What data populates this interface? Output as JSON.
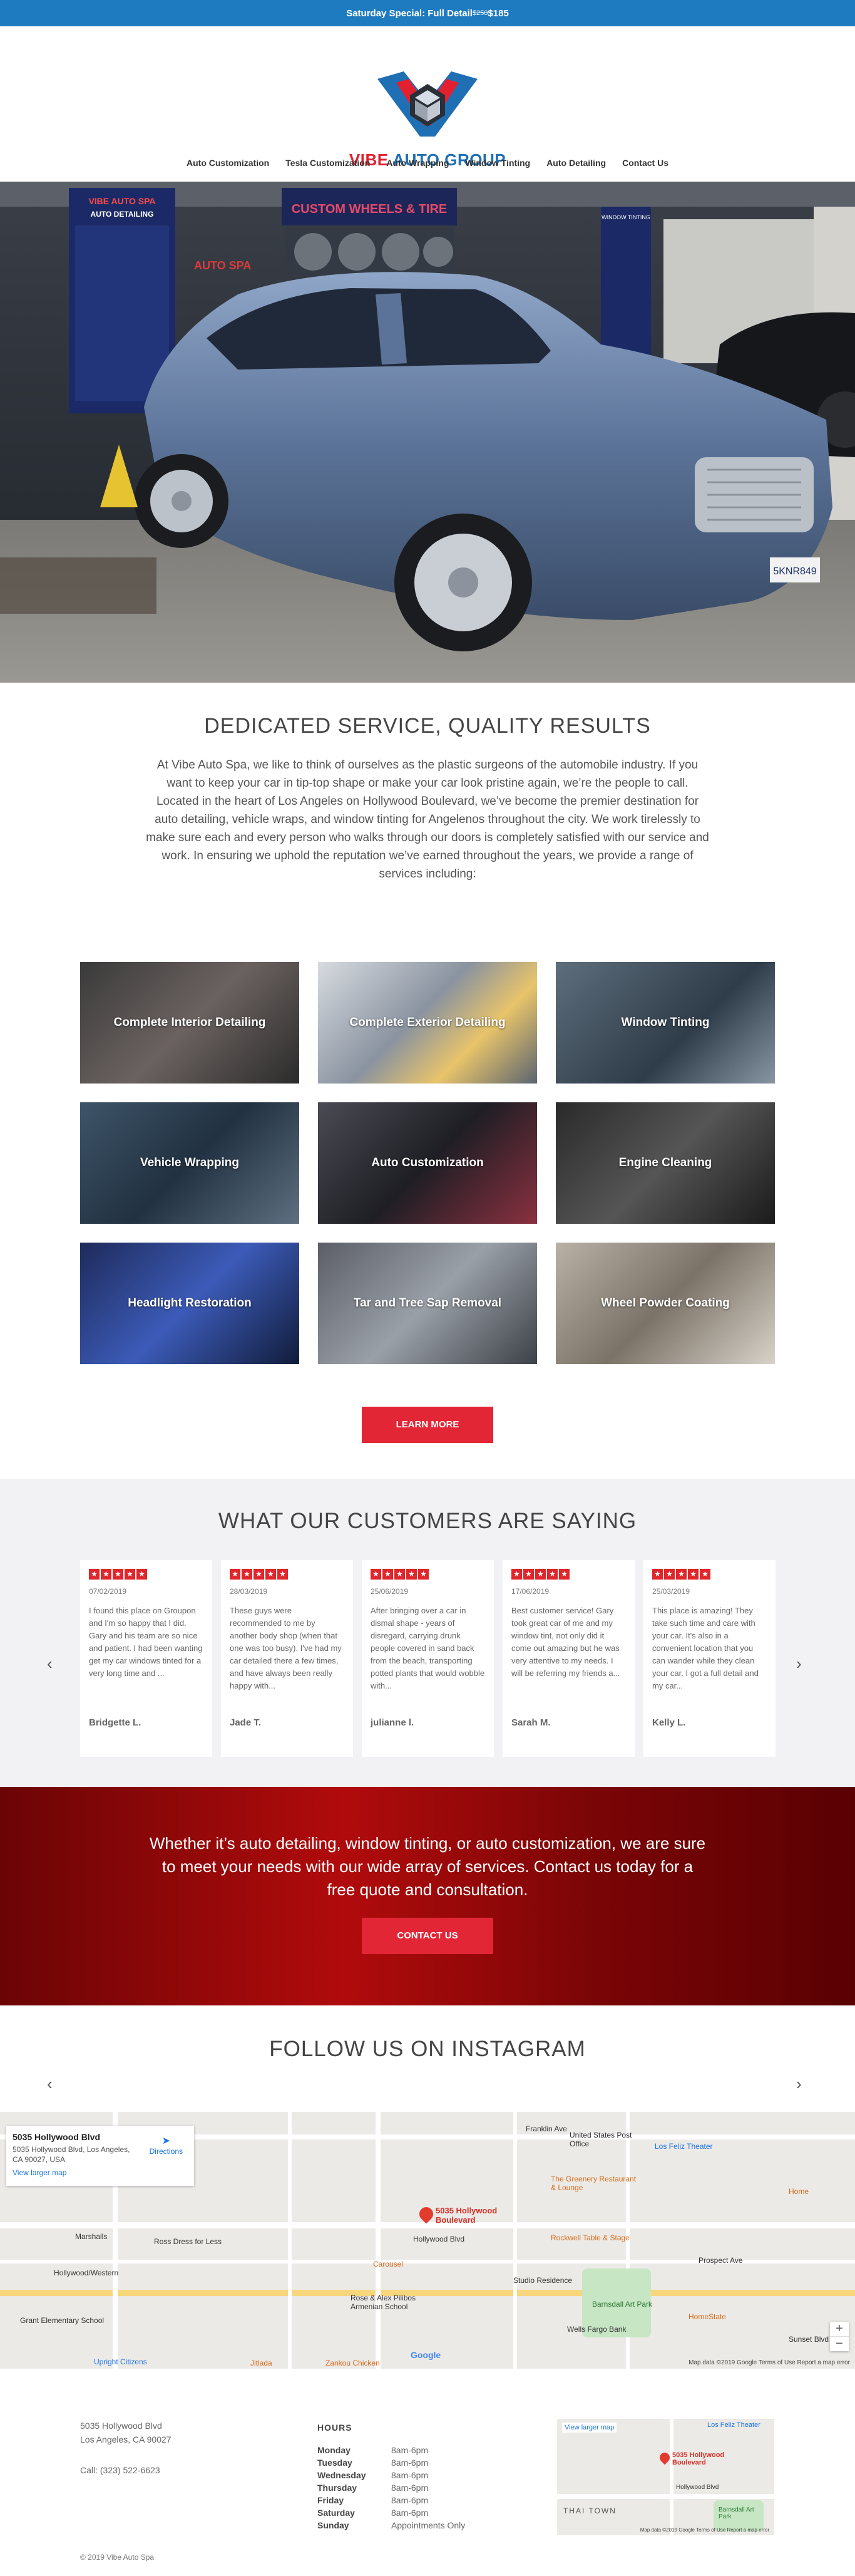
{
  "topbar": {
    "text": "Saturday Special: Full Detail ",
    "strike": "$250",
    "price": " $185"
  },
  "brand": {
    "name_red": "VIBE ",
    "name_blue": "AUTO GROUP"
  },
  "nav": [
    "Auto Customization",
    "Tesla Customization",
    "Auto Wrapping",
    "Window Tinting",
    "Auto Detailing",
    "Contact Us"
  ],
  "hero": {
    "sign_left": "VIBE AUTO SPA",
    "sign_left_sub": "AUTO DETAILING",
    "sign_top": "CUSTOM WHEELS & TIRE",
    "sign_right": "WINDOW TINTING",
    "plate": "5KNR849",
    "auto_spa": "AUTO SPA"
  },
  "intro": {
    "heading": "DEDICATED SERVICE, QUALITY RESULTS",
    "body": "At Vibe Auto Spa, we like to think of ourselves as the plastic surgeons of the automobile industry. If you want to keep your car in tip-top shape or make your car look pristine again, we’re the people to call. Located in the heart of Los Angeles on Hollywood Boulevard, we’ve become the premier destination for auto detailing, vehicle wraps, and window tinting for Angelenos throughout the city. We work tirelessly to make sure each and every person who walks through our doors is completely satisfied with our service and work. In ensuring we uphold the reputation we’ve earned throughout the years, we provide a range of services including:"
  },
  "services": [
    "Complete Interior Detailing",
    "Complete Exterior Detailing",
    "Window Tinting",
    "Vehicle Wrapping",
    "Auto Customization",
    "Engine Cleaning",
    "Headlight Restoration",
    "Tar and Tree Sap Removal",
    "Wheel Powder Coating"
  ],
  "learn_more": "LEARN MORE",
  "testimonials": {
    "heading": "WHAT OUR CUSTOMERS ARE SAYING",
    "items": [
      {
        "rating": 5,
        "date": "07/02/2019",
        "text": "I found this place on Groupon and I'm so happy that I did. Gary and his team are so nice and patient. I had been wanting get my car windows tinted for a very long time and ...",
        "name": "Bridgette L."
      },
      {
        "rating": 5,
        "date": "28/03/2019",
        "text": "These guys were recommended to me by another body shop (when that one was too busy). I've had my car detailed there a few times, and have always been really happy with...",
        "name": "Jade T."
      },
      {
        "rating": 5,
        "date": "25/06/2019",
        "text": "After bringing over a car in dismal shape - years of disregard, carrying drunk people covered in sand back from the beach, transporting potted plants that would wobble with...",
        "name": "julianne l."
      },
      {
        "rating": 5,
        "date": "17/06/2019",
        "text": "Best customer service! Gary took great car of me and my window tint, not only did it come out amazing but he was very attentive to my needs. I will be referring my friends a...",
        "name": "Sarah M."
      },
      {
        "rating": 5,
        "date": "25/03/2019",
        "text": "This place is amazing! They take such time and care with your car. It's also in a convenient location that you can wander while they clean your car. I got a full detail and my car...",
        "name": "Kelly L."
      }
    ]
  },
  "cta": {
    "text": "Whether it’s auto detailing, window tinting, or auto customization, we are sure to meet your needs with our wide array of services. Contact us today for a free quote and consultation.",
    "button": "CONTACT US"
  },
  "instagram": {
    "heading": "FOLLOW US ON INSTAGRAM"
  },
  "map": {
    "card_title": "5035 Hollywood Blvd",
    "card_address": "5035 Hollywood Blvd, Los Angeles, CA 90027, USA",
    "card_link": "View larger map",
    "directions": "Directions",
    "pin_label": "5035 Hollywood Boulevard",
    "footer": "Map data ©2019 Google   Terms of Use   Report a map error",
    "labels": [
      "Franklin Ave",
      "Hollywood Blvd",
      "Sunset Blvd",
      "Marshalls",
      "Ross Dress for Less",
      "Los Feliz Theater",
      "Barnsdall Art Park",
      "Hollywood/Western",
      "Prospect Ave",
      "Carousel",
      "Grant Elementary School",
      "Rose & Alex Pilibos Armenian School",
      "Wells Fargo Bank",
      "HomeState",
      "Studio Residence",
      "Zankou Chicken",
      "Jitlada",
      "Rockwell Table & Stage",
      "The Greenery Restaurant & Lounge",
      "United States Post Office",
      "Upright Citizens",
      "Home",
      "Google"
    ]
  },
  "footer": {
    "address1": "5035 Hollywood Blvd",
    "address2": "Los Angeles, CA 90027",
    "phone": "Call: (323) 522-6623",
    "hours_title": "HOURS",
    "hours": [
      {
        "day": "Monday",
        "time": "8am-6pm"
      },
      {
        "day": "Tuesday",
        "time": "8am-6pm"
      },
      {
        "day": "Wednesday",
        "time": "8am-6pm"
      },
      {
        "day": "Thursday",
        "time": "8am-6pm"
      },
      {
        "day": "Friday",
        "time": "8am-6pm"
      },
      {
        "day": "Saturday",
        "time": "8am-6pm"
      },
      {
        "day": "Sunday",
        "time": "Appointments Only"
      }
    ],
    "mini_map_labels": [
      "View larger map",
      "Los Feliz Theater",
      "5035 Hollywood Boulevard",
      "THAI TOWN",
      "Hollywood Blvd",
      "Barnsdall Art Park",
      "Map data ©2019 Google   Terms of Use   Report a map error"
    ],
    "copyright": "© 2019 Vibe Auto Spa"
  },
  "colors": {
    "accent_red": "#e32636",
    "topbar_blue": "#1f7bc0",
    "brand_blue": "#1f6fb5"
  }
}
